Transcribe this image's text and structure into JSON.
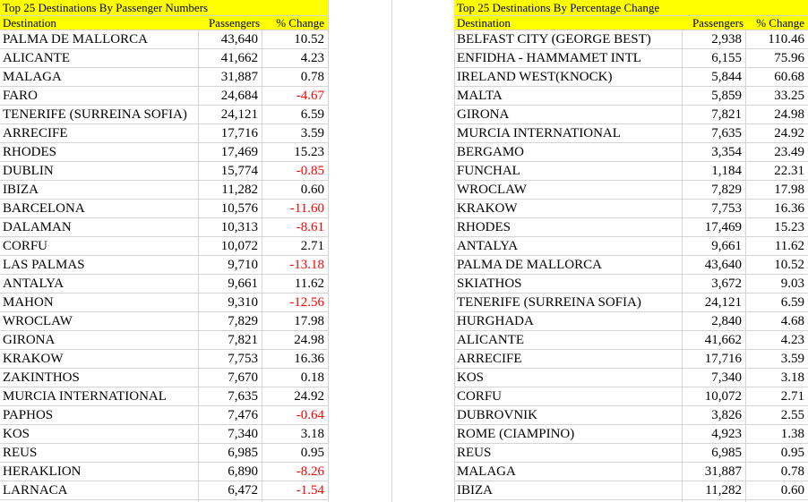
{
  "left_table": {
    "title": "Top 25 Destinations By Passenger Numbers",
    "headers": {
      "destination": "Destination",
      "passengers": "Passengers",
      "change": "% Change"
    },
    "rows": [
      {
        "destination": "PALMA DE MALLORCA",
        "passengers": "43,640",
        "change": "10.52"
      },
      {
        "destination": "ALICANTE",
        "passengers": "41,662",
        "change": "4.23"
      },
      {
        "destination": "MALAGA",
        "passengers": "31,887",
        "change": "0.78"
      },
      {
        "destination": "FARO",
        "passengers": "24,684",
        "change": "-4.67"
      },
      {
        "destination": "TENERIFE (SURREINA SOFIA)",
        "passengers": "24,121",
        "change": "6.59"
      },
      {
        "destination": "ARRECIFE",
        "passengers": "17,716",
        "change": "3.59"
      },
      {
        "destination": "RHODES",
        "passengers": "17,469",
        "change": "15.23"
      },
      {
        "destination": "DUBLIN",
        "passengers": "15,774",
        "change": "-0.85"
      },
      {
        "destination": "IBIZA",
        "passengers": "11,282",
        "change": "0.60"
      },
      {
        "destination": "BARCELONA",
        "passengers": "10,576",
        "change": "-11.60"
      },
      {
        "destination": "DALAMAN",
        "passengers": "10,313",
        "change": "-8.61"
      },
      {
        "destination": "CORFU",
        "passengers": "10,072",
        "change": "2.71"
      },
      {
        "destination": "LAS PALMAS",
        "passengers": "9,710",
        "change": "-13.18"
      },
      {
        "destination": "ANTALYA",
        "passengers": "9,661",
        "change": "11.62"
      },
      {
        "destination": "MAHON",
        "passengers": "9,310",
        "change": "-12.56"
      },
      {
        "destination": "WROCLAW",
        "passengers": "7,829",
        "change": "17.98"
      },
      {
        "destination": "GIRONA",
        "passengers": "7,821",
        "change": "24.98"
      },
      {
        "destination": "KRAKOW",
        "passengers": "7,753",
        "change": "16.36"
      },
      {
        "destination": "ZAKINTHOS",
        "passengers": "7,670",
        "change": "0.18"
      },
      {
        "destination": "MURCIA INTERNATIONAL",
        "passengers": "7,635",
        "change": "24.92"
      },
      {
        "destination": "PAPHOS",
        "passengers": "7,476",
        "change": "-0.64"
      },
      {
        "destination": "KOS",
        "passengers": "7,340",
        "change": "3.18"
      },
      {
        "destination": "REUS",
        "passengers": "6,985",
        "change": "0.95"
      },
      {
        "destination": "HERAKLION",
        "passengers": "6,890",
        "change": "-8.26"
      },
      {
        "destination": "LARNACA",
        "passengers": "6,472",
        "change": "-1.54"
      }
    ]
  },
  "right_table": {
    "title": "Top 25 Destinations By Percentage Change",
    "headers": {
      "destination": "Destination",
      "passengers": "Passengers",
      "change": "% Change"
    },
    "rows": [
      {
        "destination": "BELFAST CITY (GEORGE BEST)",
        "passengers": "2,938",
        "change": "110.46"
      },
      {
        "destination": "ENFIDHA - HAMMAMET INTL",
        "passengers": "6,155",
        "change": "75.96"
      },
      {
        "destination": "IRELAND WEST(KNOCK)",
        "passengers": "5,844",
        "change": "60.68"
      },
      {
        "destination": "MALTA",
        "passengers": "5,859",
        "change": "33.25"
      },
      {
        "destination": "GIRONA",
        "passengers": "7,821",
        "change": "24.98"
      },
      {
        "destination": "MURCIA INTERNATIONAL",
        "passengers": "7,635",
        "change": "24.92"
      },
      {
        "destination": "BERGAMO",
        "passengers": "3,354",
        "change": "23.49"
      },
      {
        "destination": "FUNCHAL",
        "passengers": "1,184",
        "change": "22.31"
      },
      {
        "destination": "WROCLAW",
        "passengers": "7,829",
        "change": "17.98"
      },
      {
        "destination": "KRAKOW",
        "passengers": "7,753",
        "change": "16.36"
      },
      {
        "destination": "RHODES",
        "passengers": "17,469",
        "change": "15.23"
      },
      {
        "destination": "ANTALYA",
        "passengers": "9,661",
        "change": "11.62"
      },
      {
        "destination": "PALMA DE MALLORCA",
        "passengers": "43,640",
        "change": "10.52"
      },
      {
        "destination": "SKIATHOS",
        "passengers": "3,672",
        "change": "9.03"
      },
      {
        "destination": "TENERIFE (SURREINA SOFIA)",
        "passengers": "24,121",
        "change": "6.59"
      },
      {
        "destination": "HURGHADA",
        "passengers": "2,840",
        "change": "4.68"
      },
      {
        "destination": "ALICANTE",
        "passengers": "41,662",
        "change": "4.23"
      },
      {
        "destination": "ARRECIFE",
        "passengers": "17,716",
        "change": "3.59"
      },
      {
        "destination": "KOS",
        "passengers": "7,340",
        "change": "3.18"
      },
      {
        "destination": "CORFU",
        "passengers": "10,072",
        "change": "2.71"
      },
      {
        "destination": "DUBROVNIK",
        "passengers": "3,826",
        "change": "2.55"
      },
      {
        "destination": "ROME (CIAMPINO)",
        "passengers": "4,923",
        "change": "1.38"
      },
      {
        "destination": "REUS",
        "passengers": "6,985",
        "change": "0.95"
      },
      {
        "destination": "MALAGA",
        "passengers": "31,887",
        "change": "0.78"
      },
      {
        "destination": "IBIZA",
        "passengers": "11,282",
        "change": "0.60"
      }
    ]
  },
  "colors": {
    "header_fill": "#ffff00",
    "negative_text": "#ff0000",
    "gridline": "#d4d4d4"
  }
}
